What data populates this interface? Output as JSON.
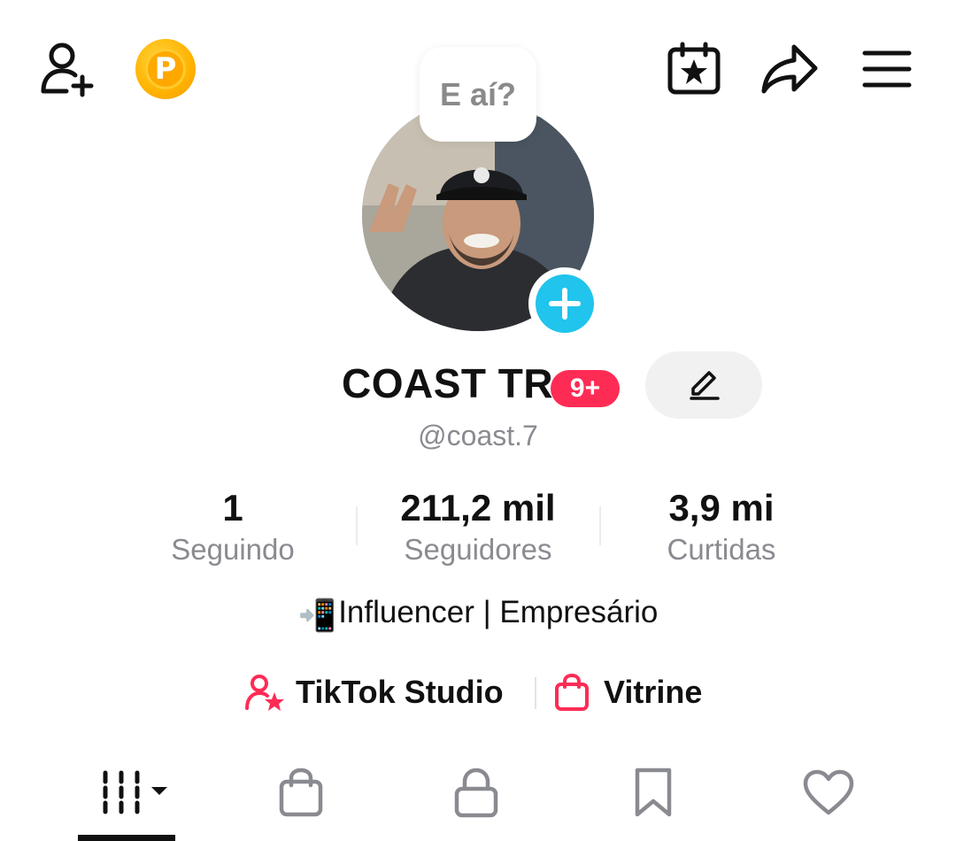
{
  "header": {
    "add_friend_icon": "add-person-icon",
    "coin_letter": "P",
    "calendar_icon": "calendar-star-icon",
    "share_icon": "share-arrow-icon",
    "menu_icon": "hamburger-menu-icon"
  },
  "profile": {
    "bubble_text": "E aí?",
    "display_name": "COAST TR",
    "notification_badge": "9+",
    "username": "@coast.7",
    "bio_emoji": "📲",
    "bio_text": "Influencer | Empresário"
  },
  "stats": [
    {
      "value": "1",
      "label": "Seguindo"
    },
    {
      "value": "211,2 mil",
      "label": "Seguidores"
    },
    {
      "value": "3,9 mi",
      "label": "Curtidas"
    }
  ],
  "links": {
    "studio_label": "TikTok Studio",
    "vitrine_label": "Vitrine"
  },
  "tabs": [
    {
      "icon": "grid-videos-icon",
      "active": true
    },
    {
      "icon": "shopping-bag-icon",
      "active": false
    },
    {
      "icon": "lock-icon",
      "active": false
    },
    {
      "icon": "bookmark-icon",
      "active": false
    },
    {
      "icon": "heart-icon",
      "active": false
    }
  ],
  "colors": {
    "accent_red": "#fe2c55",
    "avatar_add_blue": "#20c4ec",
    "coin_orange": "#ffa800",
    "secondary_text": "#8a8b91"
  }
}
